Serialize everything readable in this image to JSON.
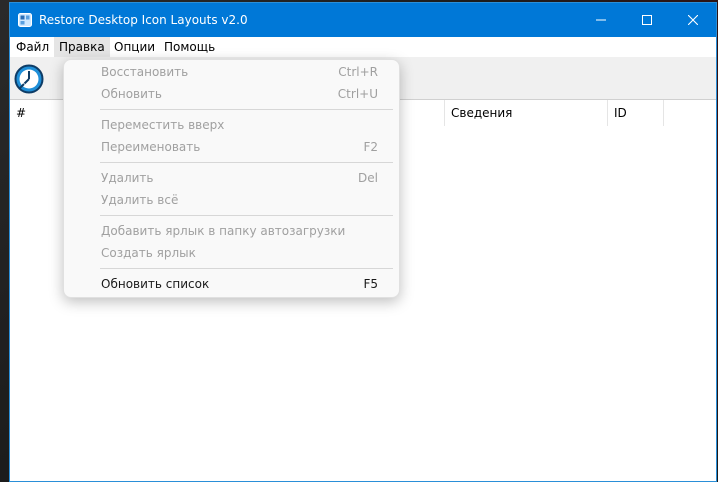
{
  "window": {
    "title": "Restore Desktop Icon Layouts v2.0",
    "accent": "#0078d7"
  },
  "menubar": {
    "items": [
      {
        "label": "Файл"
      },
      {
        "label": "Правка"
      },
      {
        "label": "Опции"
      },
      {
        "label": "Помощь"
      }
    ]
  },
  "toolbar": {
    "icon": "restore-layout-icon"
  },
  "list": {
    "columns": [
      "#",
      "Сведения",
      "ID"
    ]
  },
  "edit_menu": {
    "items": [
      {
        "label": "Восстановить",
        "shortcut": "Ctrl+R",
        "enabled": false
      },
      {
        "label": "Обновить",
        "shortcut": "Ctrl+U",
        "enabled": false
      },
      {
        "label": "Переместить вверх",
        "shortcut": "",
        "enabled": false
      },
      {
        "label": "Переименовать",
        "shortcut": "F2",
        "enabled": false
      },
      {
        "label": "Удалить",
        "shortcut": "Del",
        "enabled": false
      },
      {
        "label": "Удалить всё",
        "shortcut": "",
        "enabled": false
      },
      {
        "label": "Добавить ярлык в папку автозагрузки",
        "shortcut": "",
        "enabled": false
      },
      {
        "label": "Создать ярлык",
        "shortcut": "",
        "enabled": false
      },
      {
        "label": "Обновить список",
        "shortcut": "F5",
        "enabled": true
      }
    ]
  }
}
